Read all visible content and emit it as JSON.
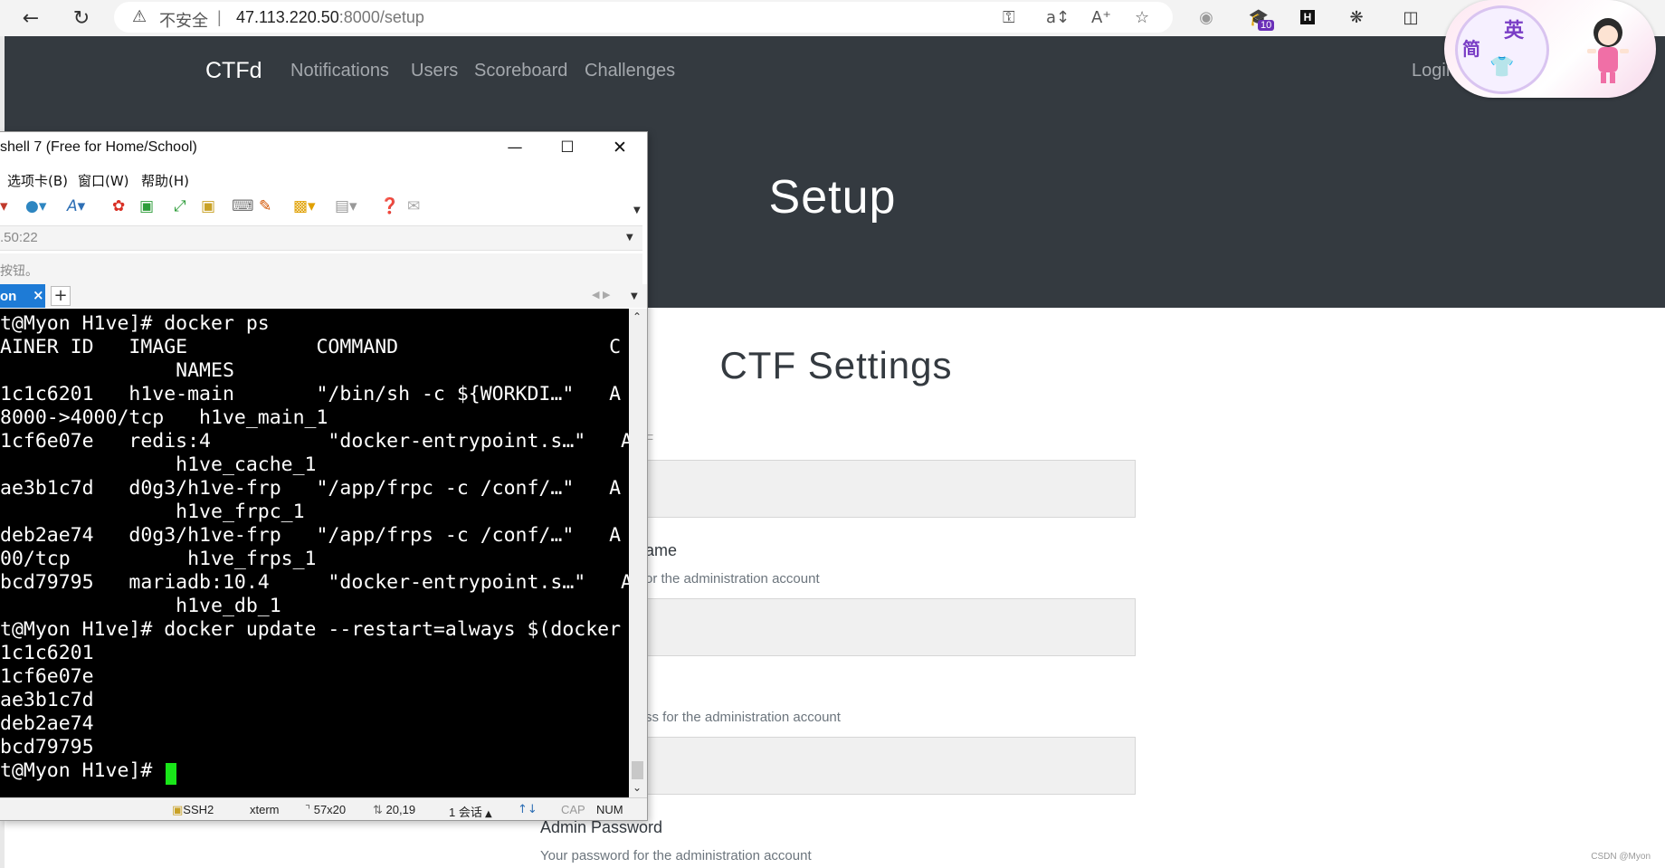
{
  "browser": {
    "insecure_label": "不安全",
    "separator": "|",
    "url_host": "47.113.220.50",
    "url_path": ":8000/setup",
    "extension_badge": "10",
    "icons": [
      "back-arrow-icon",
      "reload-icon",
      "warning-icon",
      "key-icon",
      "read-aloud-icon",
      "text-size-icon",
      "star-icon",
      "circle-extension-icon",
      "graduation-cap-extension-icon",
      "h-extension-icon",
      "puzzle-extensions-icon",
      "split-screen-icon"
    ]
  },
  "site": {
    "brand": "CTFd",
    "nav": [
      "Notifications",
      "Users",
      "Scoreboard",
      "Challenges"
    ],
    "login": "Login",
    "hero_title": "Setup",
    "section_title": "CTF Settings",
    "fields": [
      {
        "label": "ame",
        "help": "or the administration account"
      },
      {
        "label": "",
        "help": "ss for the administration account"
      },
      {
        "label": "Admin Password",
        "help": "Your password for the administration account"
      }
    ],
    "partial_label": "F",
    "watermark": "CSDN @Myon⁠⁠⁠"
  },
  "sticker": {
    "char_en": "英",
    "char_cn": "简"
  },
  "xshell": {
    "title": "shell 7 (Free for Home/School)",
    "menu": [
      "选项卡(B)",
      "窗口(W)",
      "帮助(H)"
    ],
    "address": ".50:22",
    "hint": "按钮。",
    "tab_label": "on",
    "terminal_lines": [
      "t@Myon H1ve]# docker ps",
      "AINER ID   IMAGE           COMMAND                  C",
      "               NAMES",
      "1c1c6201   h1ve-main       \"/bin/sh -c ${WORKDI…\"   A",
      "8000->4000/tcp   h1ve_main_1",
      "1cf6e07e   redis:4          \"docker-entrypoint.s…\"   A",
      "               h1ve_cache_1",
      "ae3b1c7d   d0g3/h1ve-frp   \"/app/frpc -c /conf/…\"   A",
      "               h1ve_frpc_1",
      "deb2ae74   d0g3/h1ve-frp   \"/app/frps -c /conf/…\"   A",
      "00/tcp          h1ve_frps_1",
      "bcd79795   mariadb:10.4     \"docker-entrypoint.s…\"   A",
      "               h1ve_db_1",
      "t@Myon H1ve]# docker update --restart=always $(docker",
      "1c1c6201",
      "1cf6e07e",
      "ae3b1c7d",
      "deb2ae74",
      "bcd79795",
      "t@Myon H1ve]# "
    ],
    "status": {
      "protocol": "SSH2",
      "terminal": "xterm",
      "size": "57x20",
      "cursor": "20,19",
      "sessions": "1 会话",
      "cap": "CAP",
      "num": "NUM"
    }
  }
}
